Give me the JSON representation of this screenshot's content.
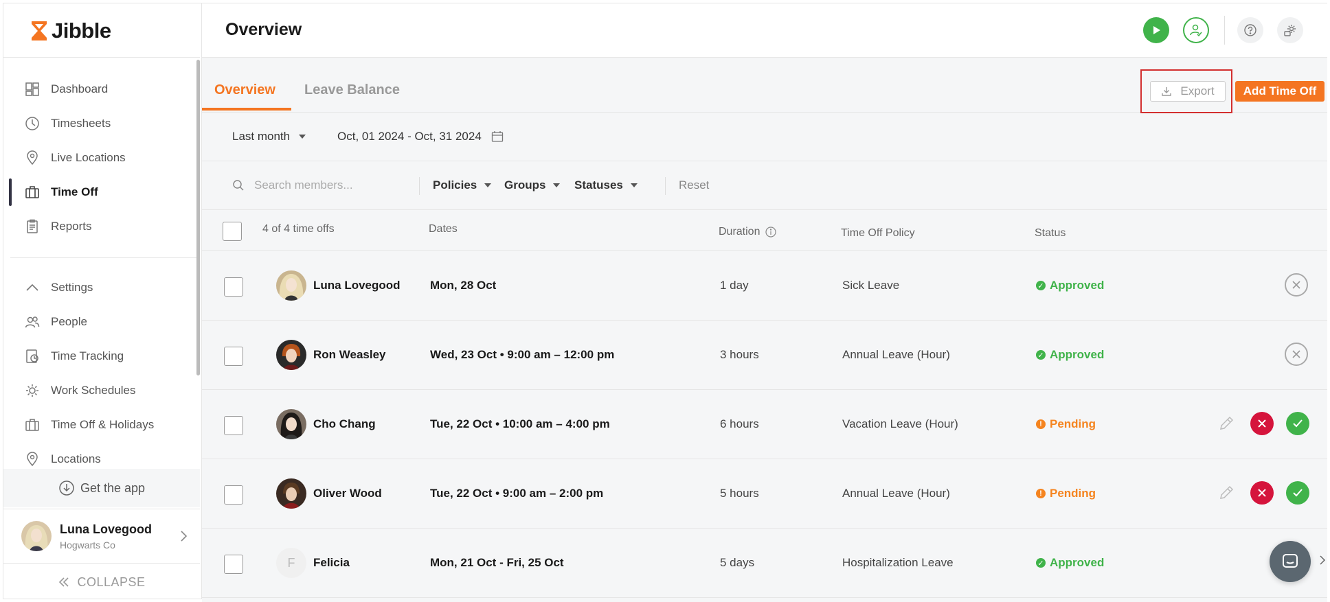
{
  "app": {
    "name": "Jibble"
  },
  "sidebar": {
    "nav_top": [
      {
        "label": "Dashboard",
        "icon": "dashboard-icon"
      },
      {
        "label": "Timesheets",
        "icon": "clock-icon"
      },
      {
        "label": "Live Locations",
        "icon": "location-pin-icon"
      },
      {
        "label": "Time Off",
        "icon": "suitcase-icon",
        "active": true
      },
      {
        "label": "Reports",
        "icon": "clipboard-icon"
      }
    ],
    "nav_settings": [
      {
        "label": "Settings",
        "icon": "chevron-up-icon"
      },
      {
        "label": "People",
        "icon": "people-icon"
      },
      {
        "label": "Time Tracking",
        "icon": "time-tracking-icon"
      },
      {
        "label": "Work Schedules",
        "icon": "sun-gear-icon"
      },
      {
        "label": "Time Off & Holidays",
        "icon": "suitcase-icon"
      },
      {
        "label": "Locations",
        "icon": "location-pin-icon"
      }
    ],
    "get_app": "Get the app",
    "user": {
      "name": "Luna Lovegood",
      "org": "Hogwarts Co"
    },
    "collapse": "COLLAPSE"
  },
  "header": {
    "title": "Overview"
  },
  "tabs": {
    "overview": "Overview",
    "leave_balance": "Leave Balance"
  },
  "actions": {
    "export": "Export",
    "add": "Add Time Off"
  },
  "date_filter": {
    "period": "Last month",
    "range": "Oct, 01 2024 - Oct, 31 2024"
  },
  "filters": {
    "search_placeholder": "Search members...",
    "policies": "Policies",
    "groups": "Groups",
    "statuses": "Statuses",
    "reset": "Reset"
  },
  "table": {
    "count": "4 of 4 time offs",
    "columns": {
      "dates": "Dates",
      "duration": "Duration",
      "policy": "Time Off Policy",
      "status": "Status"
    },
    "rows": [
      {
        "name": "Luna Lovegood",
        "dates": "Mon, 28 Oct",
        "duration": "1 day",
        "policy": "Sick Leave",
        "status": "Approved"
      },
      {
        "name": "Ron Weasley",
        "dates": "Wed, 23 Oct • 9:00 am – 12:00 pm",
        "duration": "3 hours",
        "policy": "Annual Leave (Hour)",
        "status": "Approved"
      },
      {
        "name": "Cho Chang",
        "dates": "Tue, 22 Oct • 10:00 am – 4:00 pm",
        "duration": "6 hours",
        "policy": "Vacation Leave (Hour)",
        "status": "Pending"
      },
      {
        "name": "Oliver Wood",
        "dates": "Tue, 22 Oct • 9:00 am – 2:00 pm",
        "duration": "5 hours",
        "policy": "Annual Leave (Hour)",
        "status": "Pending"
      },
      {
        "name": "Felicia",
        "initial": "F",
        "dates": "Mon, 21 Oct - Fri, 25 Oct",
        "duration": "5 days",
        "policy": "Hospitalization Leave",
        "status": "Approved"
      }
    ]
  },
  "colors": {
    "accent": "#f47521",
    "approved": "#40b34a",
    "pending": "#f5841f",
    "reject": "#d5143c"
  }
}
